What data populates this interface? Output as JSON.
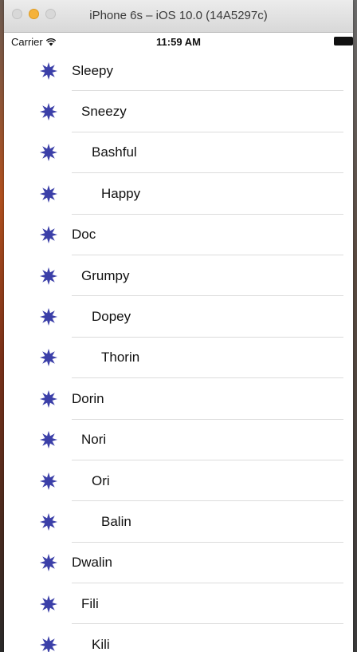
{
  "window": {
    "title": "iPhone 6s – iOS 10.0 (14A5297c)"
  },
  "status_bar": {
    "carrier": "Carrier",
    "time": "11:59 AM"
  },
  "accent_color": "#3b3fa8",
  "list": {
    "icon": "star-burst-icon",
    "items": [
      {
        "label": "Sleepy",
        "indent": 0
      },
      {
        "label": "Sneezy",
        "indent": 1
      },
      {
        "label": "Bashful",
        "indent": 2
      },
      {
        "label": "Happy",
        "indent": 3
      },
      {
        "label": "Doc",
        "indent": 0
      },
      {
        "label": "Grumpy",
        "indent": 1
      },
      {
        "label": "Dopey",
        "indent": 2
      },
      {
        "label": "Thorin",
        "indent": 3
      },
      {
        "label": "Dorin",
        "indent": 0
      },
      {
        "label": "Nori",
        "indent": 1
      },
      {
        "label": "Ori",
        "indent": 2
      },
      {
        "label": "Balin",
        "indent": 3
      },
      {
        "label": "Dwalin",
        "indent": 0
      },
      {
        "label": "Fili",
        "indent": 1
      },
      {
        "label": "Kili",
        "indent": 2
      }
    ]
  }
}
